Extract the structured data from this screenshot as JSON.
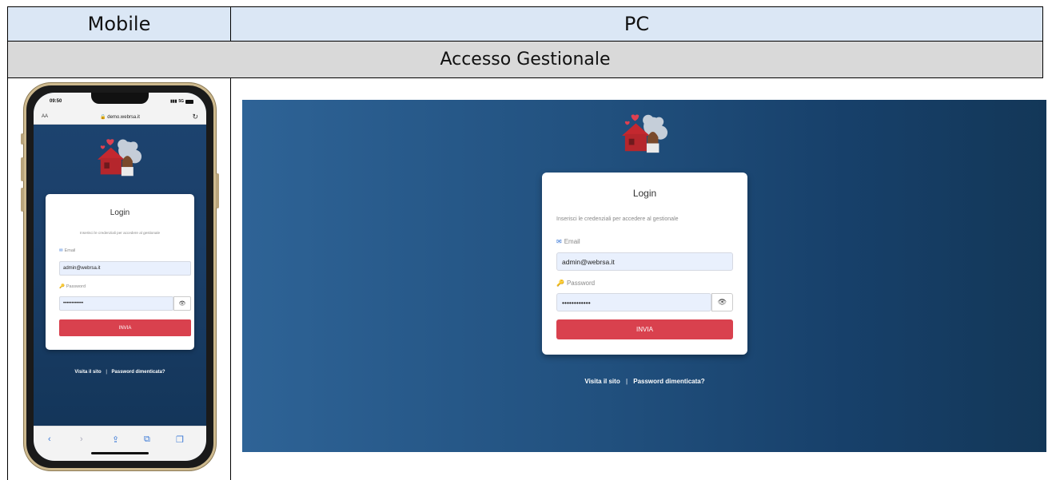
{
  "table": {
    "col_mobile": "Mobile",
    "col_pc": "PC",
    "section": "Accesso Gestionale"
  },
  "phone": {
    "time": "09:50",
    "network": "5G",
    "aa": "AA",
    "url": "demo.webrsa.it"
  },
  "login": {
    "title": "Login",
    "instructions": "Inserisci le credenziali per accedere al gestionale",
    "email_label": "Email",
    "email_value": "admin@webrsa.it",
    "password_label": "Password",
    "password_value": "••••••••••••",
    "submit_label": "INVIA",
    "visit_link": "Visita il sito",
    "separator": "|",
    "forgot_link": "Password dimenticata?"
  },
  "colors": {
    "header_bg": "#dbe7f5",
    "section_bg": "#d9d9d9",
    "submit_bg": "#d9414e",
    "input_bg": "#e9f0fd",
    "gradient_dark": "#133758",
    "gradient_light": "#2e6396"
  },
  "icons": [
    "envelope-icon",
    "key-icon",
    "eye-icon",
    "lock-icon",
    "reload-icon",
    "back-icon",
    "forward-icon",
    "share-icon",
    "bookmarks-icon",
    "tabs-icon"
  ]
}
